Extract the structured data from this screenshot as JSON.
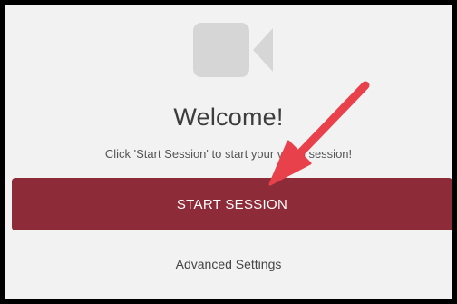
{
  "welcome": {
    "title": "Welcome!",
    "subtitle": "Click 'Start Session' to start your video session!",
    "icon": "video-camera-icon"
  },
  "actions": {
    "start_label": "START SESSION",
    "advanced_label": "Advanced Settings"
  },
  "annotation": {
    "icon": "red-arrow-icon",
    "color": "#e8414b"
  },
  "colors": {
    "button": "#8e2b38",
    "background": "#f2f2f2",
    "frame": "#000000"
  }
}
